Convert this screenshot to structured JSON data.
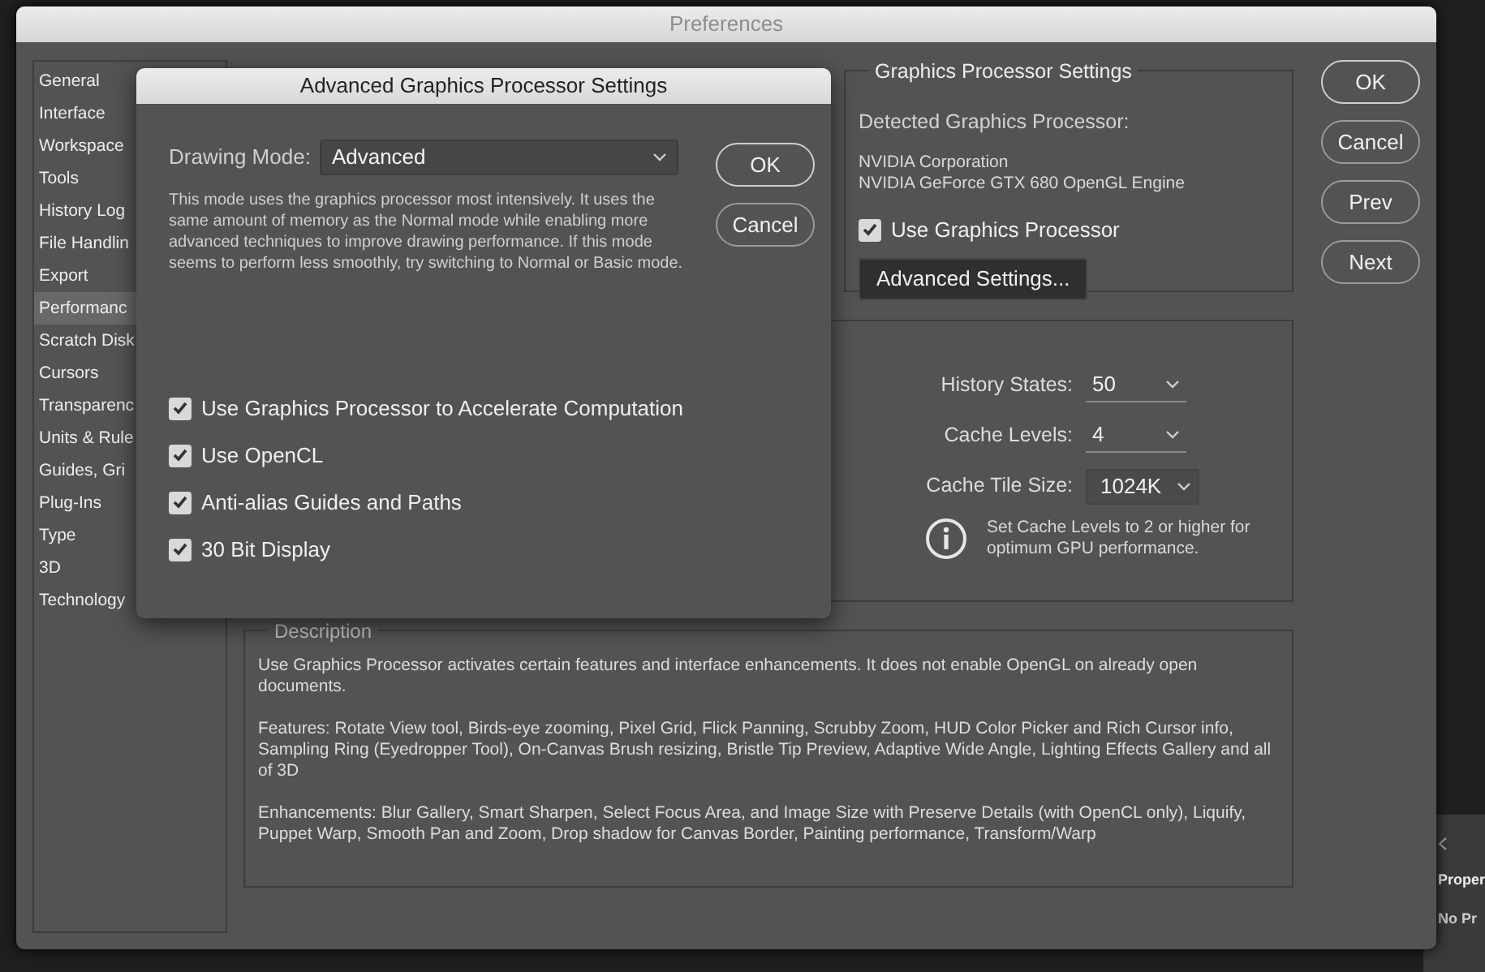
{
  "window": {
    "title": "Preferences"
  },
  "sidebar": {
    "items": [
      {
        "label": "General",
        "selected": false
      },
      {
        "label": "Interface",
        "selected": false
      },
      {
        "label": "Workspace",
        "selected": false
      },
      {
        "label": "Tools",
        "selected": false
      },
      {
        "label": "History Log",
        "selected": false
      },
      {
        "label": "File Handlin",
        "selected": false
      },
      {
        "label": "Export",
        "selected": false
      },
      {
        "label": "Performanc",
        "selected": true
      },
      {
        "label": "Scratch Disk",
        "selected": false
      },
      {
        "label": "Cursors",
        "selected": false
      },
      {
        "label": "Transparenc",
        "selected": false
      },
      {
        "label": "Units & Rule",
        "selected": false
      },
      {
        "label": "Guides, Gri",
        "selected": false
      },
      {
        "label": "Plug-Ins",
        "selected": false
      },
      {
        "label": "Type",
        "selected": false
      },
      {
        "label": "3D",
        "selected": false
      },
      {
        "label": "Technology",
        "selected": false
      }
    ]
  },
  "graphics_processor": {
    "title": "Graphics Processor Settings",
    "detected_label": "Detected Graphics Processor:",
    "vendor": "NVIDIA Corporation",
    "renderer": "NVIDIA GeForce GTX 680 OpenGL Engine",
    "use_gpu": {
      "label": "Use Graphics Processor",
      "checked": true
    },
    "advanced_button": "Advanced Settings..."
  },
  "history_cache": {
    "fields": [
      {
        "label": "History States:",
        "value": "50",
        "kind": "underline"
      },
      {
        "label": "Cache Levels:",
        "value": "4",
        "kind": "underline"
      },
      {
        "label": "Cache Tile Size:",
        "value": "1024K",
        "kind": "popup"
      }
    ],
    "note": "Set Cache Levels to 2 or higher for optimum GPU performance."
  },
  "description": {
    "title": "Description",
    "paragraphs": [
      "Use Graphics Processor activates certain features and interface enhancements. It does not enable OpenGL on already open documents.",
      "Features: Rotate View tool, Birds-eye zooming, Pixel Grid, Flick Panning, Scrubby Zoom, HUD Color Picker and Rich Cursor info, Sampling Ring (Eyedropper Tool), On-Canvas Brush resizing, Bristle Tip Preview, Adaptive Wide Angle, Lighting Effects Gallery and all of 3D",
      "Enhancements: Blur Gallery, Smart Sharpen, Select Focus Area, and Image Size with Preserve Details (with OpenCL only), Liquify, Puppet Warp, Smooth Pan and Zoom, Drop shadow for Canvas Border, Painting performance, Transform/Warp"
    ]
  },
  "buttons": [
    "OK",
    "Cancel",
    "Prev",
    "Next"
  ],
  "dialog": {
    "title": "Advanced Graphics Processor Settings",
    "drawing_mode": {
      "label": "Drawing Mode:",
      "value": "Advanced"
    },
    "explanation": "This mode uses the graphics processor most intensively.  It uses the same amount of memory as the Normal mode while enabling more advanced techniques to improve drawing performance.  If this mode seems to perform less smoothly, try switching to Normal or Basic mode.",
    "options": [
      {
        "label": "Use Graphics Processor to Accelerate Computation",
        "checked": true
      },
      {
        "label": "Use OpenCL",
        "checked": true
      },
      {
        "label": "Anti-alias Guides and Paths",
        "checked": true
      },
      {
        "label": "30 Bit Display",
        "checked": true
      }
    ],
    "buttons": [
      "OK",
      "Cancel"
    ]
  },
  "properties_panel": {
    "title": "Proper",
    "text": "No Pr"
  }
}
